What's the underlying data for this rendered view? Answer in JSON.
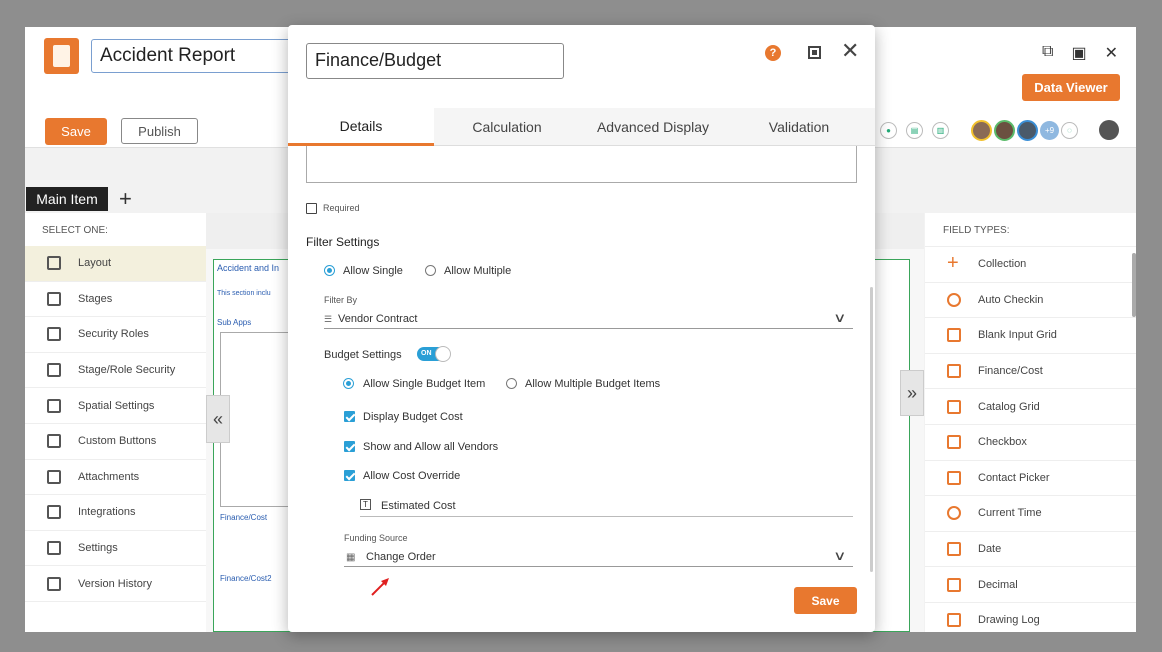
{
  "app": {
    "title": "Accident Report",
    "data_viewer_label": "Data Viewer",
    "save_label": "Save",
    "publish_label": "Publish",
    "avatar_more": "+9",
    "main_tab": "Main Item",
    "add_tab": "+"
  },
  "left_panel": {
    "heading": "SELECT ONE:",
    "items": [
      {
        "label": "Layout",
        "icon": "layout-icon"
      },
      {
        "label": "Stages",
        "icon": "stages-icon"
      },
      {
        "label": "Security Roles",
        "icon": "lock-icon"
      },
      {
        "label": "Stage/Role Security",
        "icon": "user-lock-icon"
      },
      {
        "label": "Spatial Settings",
        "icon": "spatial-icon"
      },
      {
        "label": "Custom Buttons",
        "icon": "wrench-icon"
      },
      {
        "label": "Attachments",
        "icon": "paperclip-icon"
      },
      {
        "label": "Integrations",
        "icon": "integrations-icon"
      },
      {
        "label": "Settings",
        "icon": "gears-icon"
      },
      {
        "label": "Version History",
        "icon": "history-icon"
      }
    ]
  },
  "canvas": {
    "section_title": "Accident and In",
    "section_desc": "This section inclu",
    "subapps_label": "Sub Apps",
    "finance_cost_label": "Finance/Cost",
    "finance_cost2_label": "Finance/Cost2"
  },
  "right_panel": {
    "heading": "FIELD TYPES:",
    "items": [
      {
        "label": "Collection",
        "icon": "plus-icon"
      },
      {
        "label": "Auto Checkin",
        "icon": "crosshair-icon"
      },
      {
        "label": "Blank Input Grid",
        "icon": "grid-icon"
      },
      {
        "label": "Finance/Cost",
        "icon": "dollar-doc-icon"
      },
      {
        "label": "Catalog Grid",
        "icon": "catalog-icon"
      },
      {
        "label": "Checkbox",
        "icon": "checkbox-icon"
      },
      {
        "label": "Contact Picker",
        "icon": "contact-icon"
      },
      {
        "label": "Current Time",
        "icon": "clock-icon"
      },
      {
        "label": "Date",
        "icon": "calendar-icon"
      },
      {
        "label": "Decimal",
        "icon": "decimal-icon"
      },
      {
        "label": "Drawing Log",
        "icon": "drawing-icon"
      }
    ]
  },
  "modal": {
    "title_value": "Finance/Budget",
    "help_glyph": "?",
    "close_glyph": "✕",
    "tabs": [
      "Details",
      "Calculation",
      "Advanced Display",
      "Validation"
    ],
    "required_label": "Required",
    "filter_settings_title": "Filter Settings",
    "allow_single_label": "Allow Single",
    "allow_multiple_label": "Allow Multiple",
    "filter_by_label": "Filter By",
    "filter_by_value": "Vendor Contract",
    "budget_settings_label": "Budget Settings",
    "budget_toggle_label": "ON",
    "allow_single_budget_label": "Allow Single Budget Item",
    "allow_multiple_budget_label": "Allow Multiple Budget Items",
    "display_budget_cost_label": "Display Budget Cost",
    "show_all_vendors_label": "Show and Allow all Vendors",
    "allow_cost_override_label": "Allow Cost Override",
    "estimated_cost_value": "Estimated Cost",
    "text_field_glyph": "T",
    "funding_source_label": "Funding Source",
    "funding_source_value": "Change Order",
    "save_label": "Save"
  },
  "colors": {
    "accent": "#e8782f",
    "check_blue": "#2a9fd6",
    "arrow_red": "#e02020"
  }
}
